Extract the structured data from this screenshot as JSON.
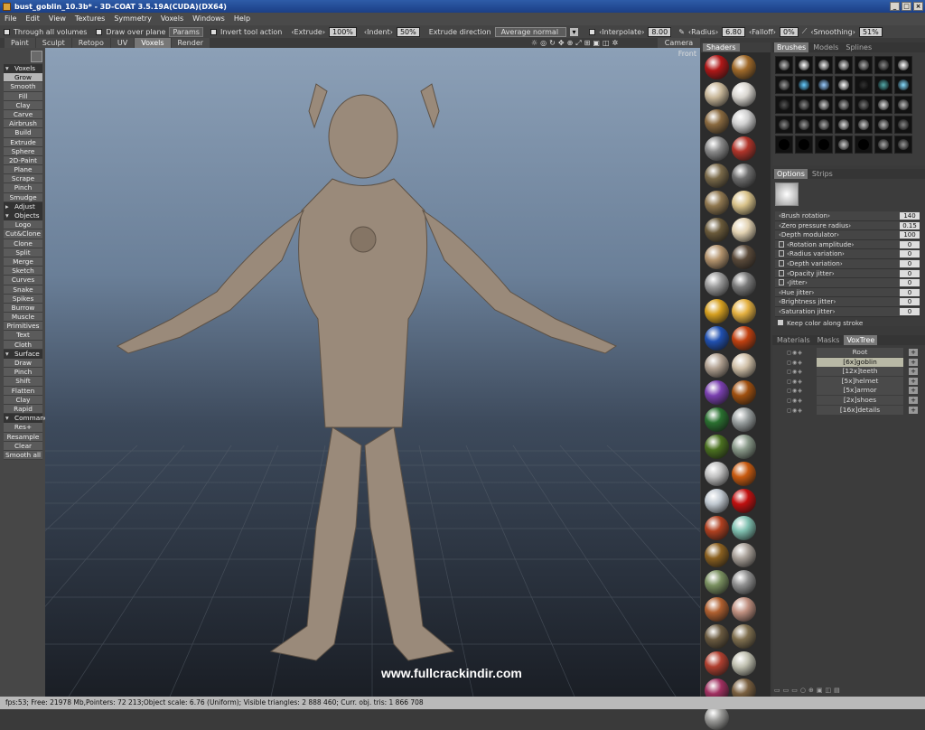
{
  "window": {
    "title": "bust_goblin_10.3b* - 3D-COAT 3.5.19A(CUDA)(DX64)"
  },
  "menu": [
    "File",
    "Edit",
    "View",
    "Textures",
    "Symmetry",
    "Voxels",
    "Windows",
    "Help"
  ],
  "toolbar": {
    "through_all_volumes": "Through all volumes",
    "draw_over_plane": "Draw over plane",
    "params": "Params",
    "invert_tool_action": "Invert tool action",
    "extrude_label": "‹Extrude›",
    "extrude_value": "100%",
    "indent_label": "‹Indent›",
    "indent_value": "50%",
    "extrude_direction_label": "Extrude direction",
    "extrude_direction_value": "Average normal",
    "interpolate_label": "‹Interpolate›",
    "interpolate_value": "8.00",
    "radius_label": "‹Radius›",
    "radius_value": "6.80",
    "falloff_label": "‹Falloff›",
    "falloff_value": "0%",
    "smoothing_label": "‹Smoothing›",
    "smoothing_value": "51%"
  },
  "room_tabs": [
    "Paint",
    "Sculpt",
    "Retopo",
    "UV",
    "Voxels",
    "Render"
  ],
  "active_room": "Voxels",
  "camera_label": "Camera",
  "viewport": {
    "view_label": "Front",
    "watermark": "www.fullcrackindir.com"
  },
  "left_tools": [
    {
      "type": "sec",
      "label": "Voxels"
    },
    {
      "type": "tool",
      "label": "Grow",
      "active": true
    },
    {
      "type": "tool",
      "label": "Smooth"
    },
    {
      "type": "tool",
      "label": "Fill"
    },
    {
      "type": "tool",
      "label": "Clay"
    },
    {
      "type": "tool",
      "label": "Carve"
    },
    {
      "type": "tool",
      "label": "Airbrush"
    },
    {
      "type": "tool",
      "label": "Build"
    },
    {
      "type": "tool",
      "label": "Extrude"
    },
    {
      "type": "tool",
      "label": "Sphere"
    },
    {
      "type": "tool",
      "label": "2D-Paint"
    },
    {
      "type": "tool",
      "label": "Plane"
    },
    {
      "type": "tool",
      "label": "Scrape"
    },
    {
      "type": "tool",
      "label": "Pinch"
    },
    {
      "type": "tool",
      "label": "Smudge"
    },
    {
      "type": "secclosed",
      "label": "Adjust"
    },
    {
      "type": "sec",
      "label": "Objects"
    },
    {
      "type": "tool",
      "label": "Logo"
    },
    {
      "type": "tool",
      "label": "Cut&Clone"
    },
    {
      "type": "tool",
      "label": "Clone"
    },
    {
      "type": "tool",
      "label": "Split"
    },
    {
      "type": "tool",
      "label": "Merge"
    },
    {
      "type": "tool",
      "label": "Sketch"
    },
    {
      "type": "tool",
      "label": "Curves"
    },
    {
      "type": "tool",
      "label": "Snake"
    },
    {
      "type": "tool",
      "label": "Spikes"
    },
    {
      "type": "tool",
      "label": "Burrow"
    },
    {
      "type": "tool",
      "label": "Muscle"
    },
    {
      "type": "tool",
      "label": "Primitives"
    },
    {
      "type": "tool",
      "label": "Text"
    },
    {
      "type": "tool",
      "label": "Cloth"
    },
    {
      "type": "sec",
      "label": "Surface"
    },
    {
      "type": "tool",
      "label": "Draw"
    },
    {
      "type": "tool",
      "label": "Pinch"
    },
    {
      "type": "tool",
      "label": "Shift"
    },
    {
      "type": "tool",
      "label": "Flatten"
    },
    {
      "type": "tool",
      "label": "Clay"
    },
    {
      "type": "tool",
      "label": "Rapid"
    },
    {
      "type": "sec",
      "label": "Commands"
    },
    {
      "type": "tool",
      "label": "Res+"
    },
    {
      "type": "tool",
      "label": "Resample"
    },
    {
      "type": "tool",
      "label": "Clear"
    },
    {
      "type": "tool",
      "label": "Smooth all"
    }
  ],
  "shaders": {
    "tab": "Shaders",
    "swatches": [
      "#b01818",
      "#a06a2a",
      "#c9b89a",
      "#d9d6d0",
      "#8a6a40",
      "#cfcfcf",
      "#8a8a8a",
      "#b0342a",
      "#7a6a4a",
      "#6e6e6e",
      "#907850",
      "#d8c28a",
      "#6a5a3a",
      "#e2d2b2",
      "#b4946e",
      "#5a4a3a",
      "#9a9a9a",
      "#7a7a7a",
      "#d6a020",
      "#e4b040",
      "#2050b0",
      "#c04010",
      "#b0a090",
      "#d0c0a8",
      "#7a40b0",
      "#a05010",
      "#2a7030",
      "#9aa0a0",
      "#4a7020",
      "#8a9a8a",
      "#c0c0c0",
      "#c85a10",
      "#c0c8d0",
      "#c01010",
      "#b04020",
      "#80c0b0",
      "#8a6020",
      "#a8a098",
      "#7a9060",
      "#909090",
      "#b06030",
      "#c09080",
      "#6a5a40",
      "#807050",
      "#b04030",
      "#c0c0b0",
      "#a03060",
      "#7a6040",
      "#9a9a98"
    ]
  },
  "brushes": {
    "tabs": [
      "Brushes",
      "Models",
      "Splines"
    ],
    "active_tab": "Brushes",
    "swatches": [
      "#bbb",
      "#fff",
      "#eee",
      "#ddd",
      "#aaa",
      "#888",
      "#fff",
      "#999",
      "#6cf",
      "#9cf",
      "#fff",
      "#333",
      "#5aa",
      "#8df",
      "#555",
      "#888",
      "#ccc",
      "#aaa",
      "#777",
      "#ddd",
      "#bbb",
      "#888",
      "#999",
      "#aaa",
      "#ddd",
      "#ccc",
      "#bbb",
      "#888",
      "#000",
      "#000",
      "#000",
      "#ccc",
      "#000",
      "#aaa",
      "#999"
    ]
  },
  "options": {
    "tabs": [
      "Options",
      "Strips"
    ],
    "active_tab": "Options",
    "rows": [
      {
        "label": "‹Brush rotation›",
        "value": "140",
        "lock": false
      },
      {
        "label": "‹Zero pressure radius›",
        "value": "0.15",
        "lock": false
      },
      {
        "label": "‹Depth modulator›",
        "value": "100",
        "lock": false
      },
      {
        "label": "‹Rotation amplitude›",
        "value": "0",
        "lock": true
      },
      {
        "label": "‹Radius variation›",
        "value": "0",
        "lock": true
      },
      {
        "label": "‹Depth variation›",
        "value": "0",
        "lock": true
      },
      {
        "label": "‹Opacity jitter›",
        "value": "0",
        "lock": true
      },
      {
        "label": "‹Jitter›",
        "value": "0",
        "lock": true
      },
      {
        "label": "‹Hue jitter›",
        "value": "0",
        "lock": false
      },
      {
        "label": "‹Brightness jitter›",
        "value": "0",
        "lock": false
      },
      {
        "label": "‹Saturation jitter›",
        "value": "0",
        "lock": false
      }
    ],
    "keep_color": "Keep color along stroke"
  },
  "voxtree": {
    "tabs": [
      "Materials",
      "Masks",
      "VoxTree"
    ],
    "active_tab": "VoxTree",
    "nodes": [
      {
        "name": "Root",
        "selected": false
      },
      {
        "name": "[6x]goblin",
        "selected": true
      },
      {
        "name": "[12x]teeth",
        "selected": false
      },
      {
        "name": "[5x]helmet",
        "selected": false
      },
      {
        "name": "[5x]armor",
        "selected": false
      },
      {
        "name": "[2x]shoes",
        "selected": false
      },
      {
        "name": "[16x]details",
        "selected": false
      }
    ],
    "footer_icons": [
      "▭",
      "▭",
      "▭",
      "○",
      "⊕",
      "▣",
      "◫",
      "▤"
    ]
  },
  "status": {
    "text": "fps:53;     Free: 21978 Mb,Pointers: 72 213;Object scale: 6.76 (Uniform); Visible triangles: 2 888 460; Curr. obj. tris: 1 866 708"
  }
}
